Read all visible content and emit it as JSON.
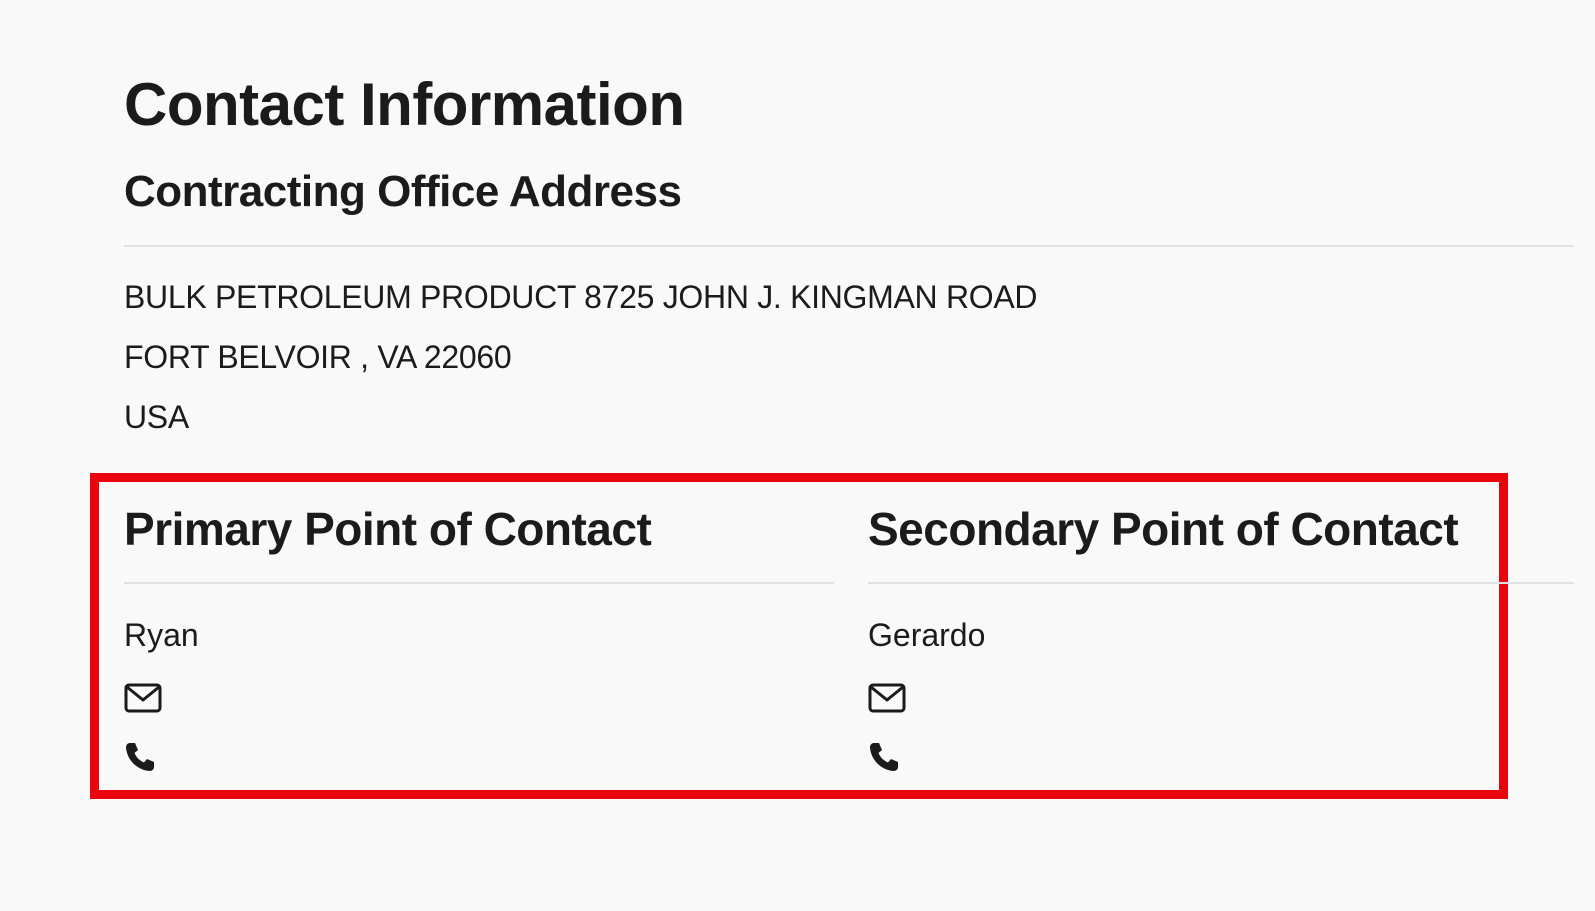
{
  "contact_information": {
    "title": "Contact Information",
    "office": {
      "heading": "Contracting Office Address",
      "address_lines": [
        "BULK PETROLEUM PRODUCT 8725 JOHN J. KINGMAN ROAD",
        "FORT BELVOIR , VA 22060",
        "USA"
      ]
    },
    "primary": {
      "heading": "Primary Point of Contact",
      "name": "Ryan",
      "email_icon": "envelope-icon",
      "phone_icon": "phone-icon"
    },
    "secondary": {
      "heading": "Secondary Point of Contact",
      "name": "Gerardo",
      "email_icon": "envelope-icon",
      "phone_icon": "phone-icon"
    }
  },
  "colors": {
    "background": "#f9f9f9",
    "text": "#1b1b1b",
    "divider": "#dfe1e2",
    "highlight_border": "#e8050d"
  }
}
